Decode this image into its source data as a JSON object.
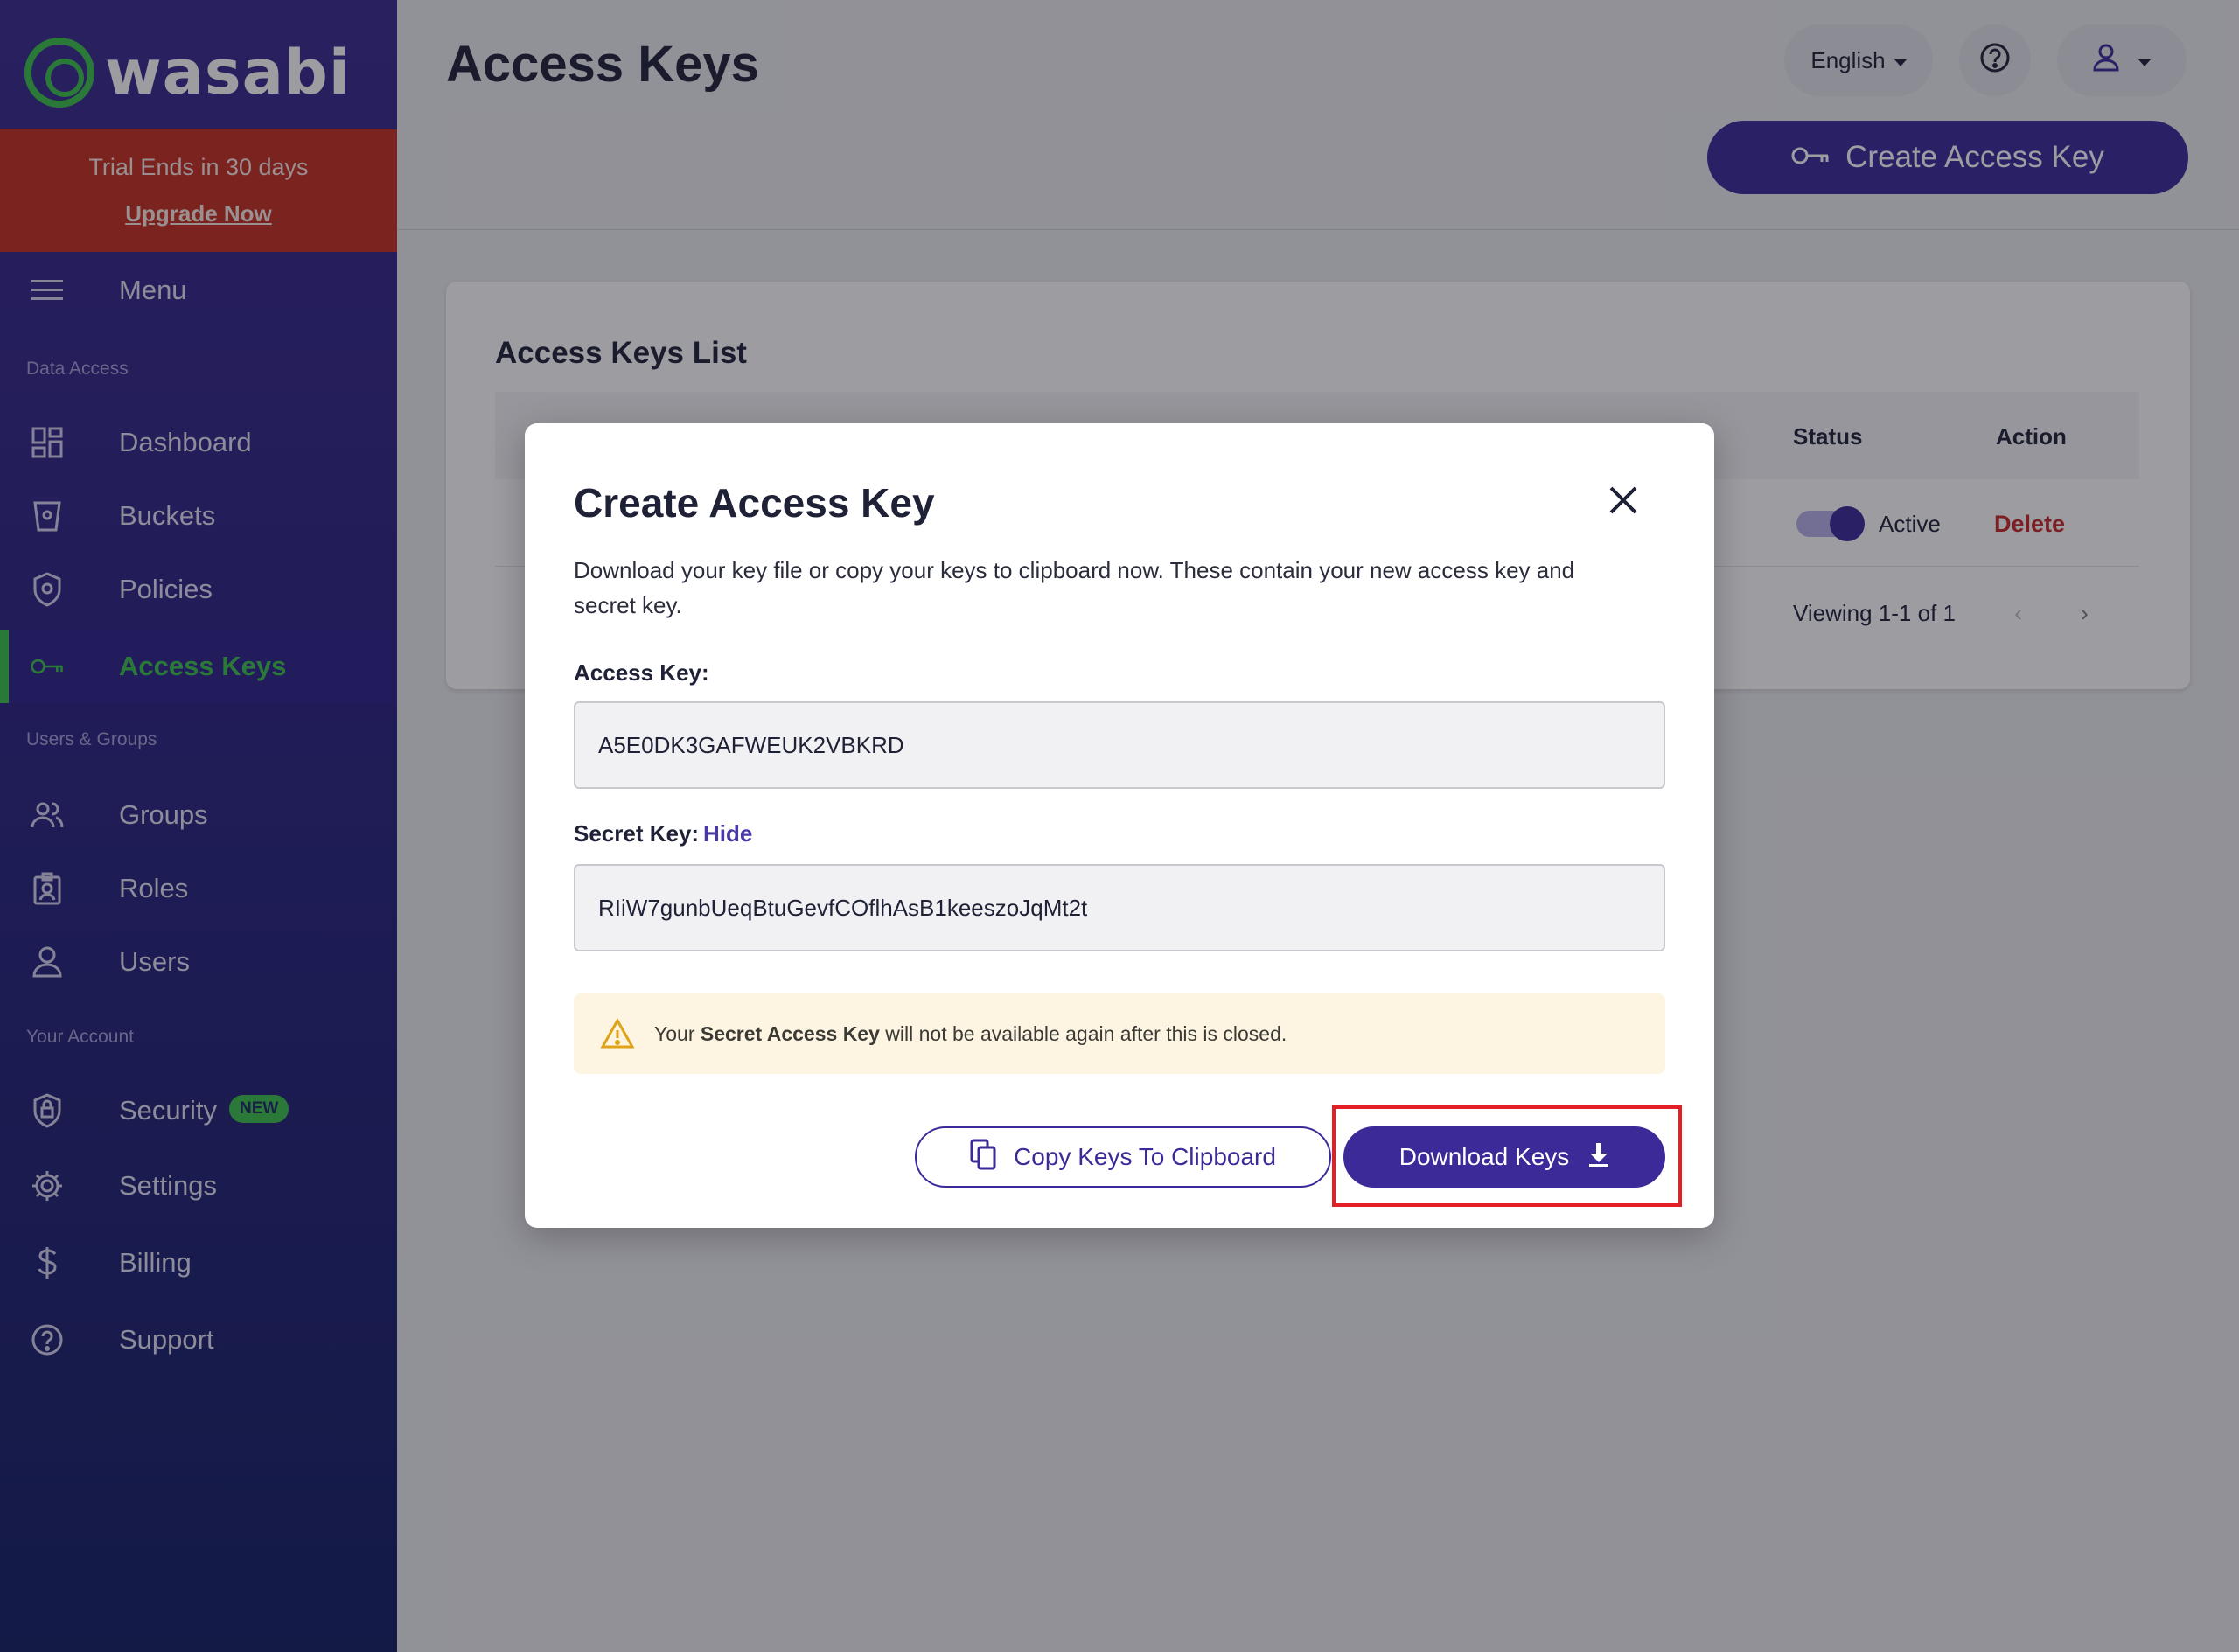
{
  "app": {
    "brand": "wasabi"
  },
  "trial": {
    "text": "Trial Ends in 30 days",
    "link": "Upgrade Now"
  },
  "sidebar": {
    "menu_label": "Menu",
    "sections": [
      "Data Access",
      "Users & Groups",
      "Your Account"
    ],
    "items": [
      {
        "label": "Dashboard",
        "icon": "dashboard-icon"
      },
      {
        "label": "Buckets",
        "icon": "bucket-icon"
      },
      {
        "label": "Policies",
        "icon": "policy-shield-icon"
      },
      {
        "label": "Access Keys",
        "icon": "key-icon",
        "active": true
      },
      {
        "label": "Groups",
        "icon": "groups-icon"
      },
      {
        "label": "Roles",
        "icon": "roles-badge-icon"
      },
      {
        "label": "Users",
        "icon": "user-icon"
      },
      {
        "label": "Security",
        "icon": "security-shield-icon",
        "badge": "NEW"
      },
      {
        "label": "Settings",
        "icon": "gear-icon"
      },
      {
        "label": "Billing",
        "icon": "dollar-icon"
      },
      {
        "label": "Support",
        "icon": "help-circle-icon"
      }
    ]
  },
  "header": {
    "title": "Access Keys",
    "language": "English",
    "create_button": "Create Access Key"
  },
  "list": {
    "title": "Access Keys List",
    "columns": {
      "status": "Status",
      "action": "Action"
    },
    "row": {
      "status": "Active",
      "action": "Delete"
    },
    "pagination": "Viewing 1-1 of 1"
  },
  "modal": {
    "title": "Create Access Key",
    "description": "Download your key file or copy your keys to clipboard now. These contain your new access key and secret key.",
    "access_key_label": "Access Key:",
    "access_key_value": "A5E0DK3GAFWEUK2VBKRD",
    "secret_key_label": "Secret Key:",
    "secret_key_toggle": "Hide",
    "secret_key_value": "RIiW7gunbUeqBtuGevfCOflhAsB1keeszoJqMt2t",
    "warning_prefix": "Your ",
    "warning_bold": "Secret Access Key",
    "warning_suffix": " will not be available again after this is closed.",
    "copy_button": "Copy Keys To Clipboard",
    "download_button": "Download Keys"
  },
  "colors": {
    "primary": "#3b2a98",
    "accent_green": "#3dc34a",
    "trial_red": "#c6301e",
    "danger": "#c62828",
    "highlight": "#e31e24"
  }
}
